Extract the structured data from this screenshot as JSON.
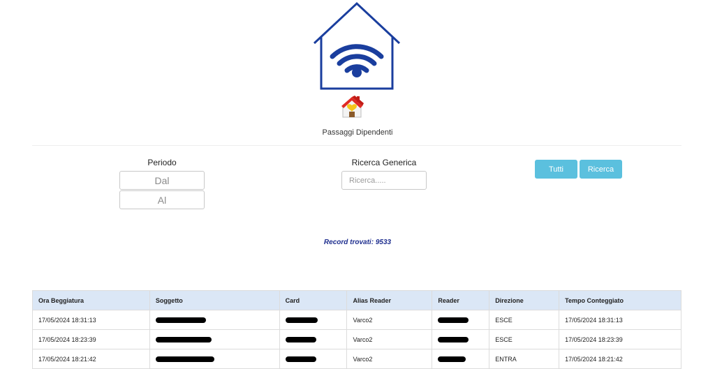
{
  "header": {
    "title": "Passaggi Dipendenti",
    "logo_icon": "house-wifi-icon",
    "home_icon": "home-icon",
    "brand_color": "#1a3e9e"
  },
  "filters": {
    "period_label": "Periodo",
    "from_placeholder": "Dal",
    "to_placeholder": "Al",
    "search_label": "Ricerca Generica",
    "search_placeholder": "Ricerca.....",
    "all_button": "Tutti",
    "search_button": "Ricerca",
    "button_color": "#5bc0de"
  },
  "results": {
    "record_count": "Record trovati: 9533"
  },
  "table": {
    "columns": [
      "Ora Beggiatura",
      "Soggetto",
      "Card",
      "Alias Reader",
      "Reader",
      "Direzione",
      "Tempo Conteggiato"
    ],
    "rows": [
      {
        "time": "17/05/2024 18:31:13",
        "soggetto": "[redacted]",
        "card": "[redacted]",
        "alias": "Varco2",
        "reader": "[redacted]",
        "direzione": "ESCE",
        "tempo": "17/05/2024 18:31:13"
      },
      {
        "time": "17/05/2024 18:23:39",
        "soggetto": "[redacted]",
        "card": "[redacted]",
        "alias": "Varco2",
        "reader": "[redacted]",
        "direzione": "ESCE",
        "tempo": "17/05/2024 18:23:39"
      },
      {
        "time": "17/05/2024 18:21:42",
        "soggetto": "[redacted]",
        "card": "[redacted]",
        "alias": "Varco2",
        "reader": "[redacted]",
        "direzione": "ENTRA",
        "tempo": "17/05/2024 18:21:42"
      }
    ]
  }
}
